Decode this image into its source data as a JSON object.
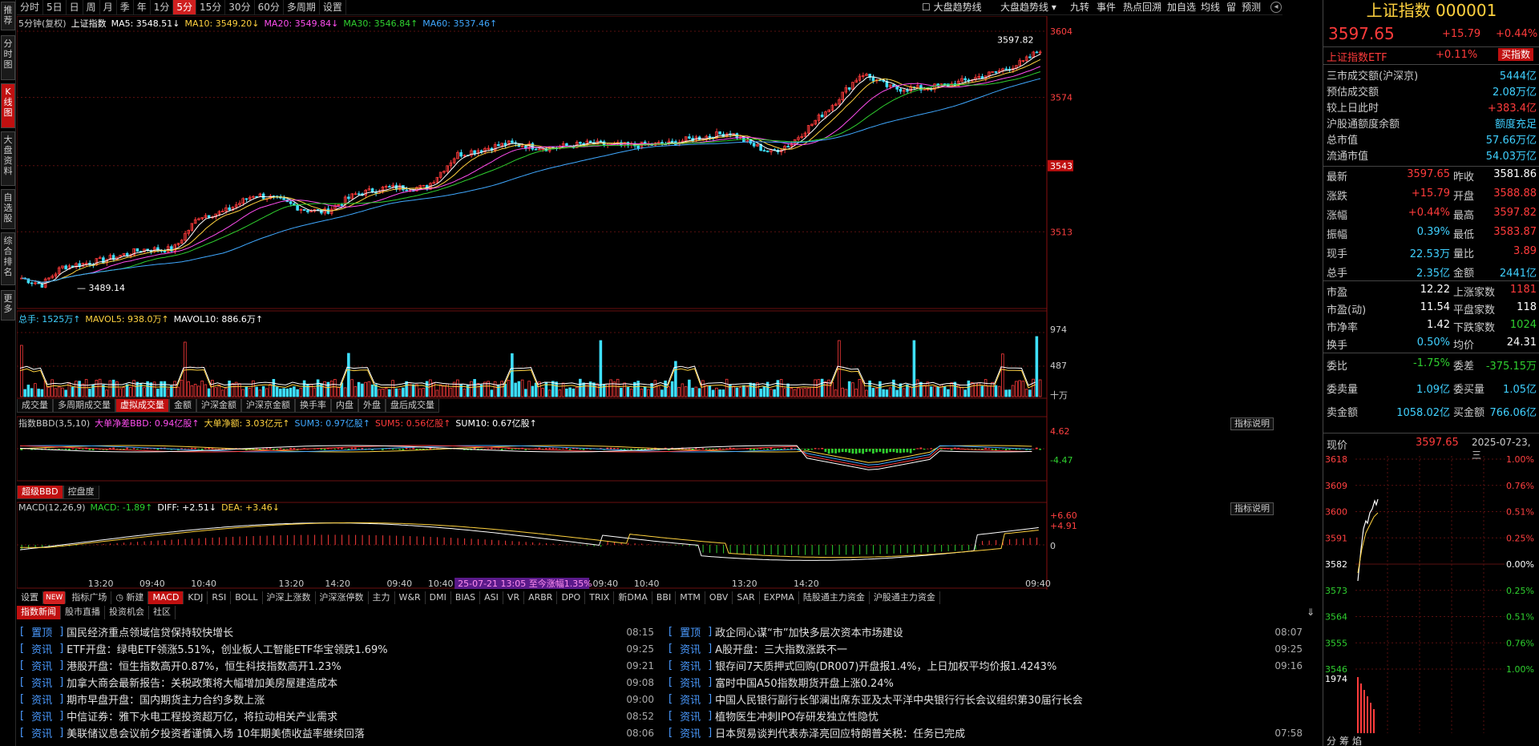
{
  "left_tabs": [
    "推荐",
    "分时图",
    "K线图",
    "大盘资料",
    "自选股",
    "综合排名",
    "更多"
  ],
  "periods": [
    "分时",
    "5日",
    "日",
    "周",
    "月",
    "季",
    "年",
    "1分",
    "5分",
    "15分",
    "30分",
    "60分",
    "多周期",
    "设置"
  ],
  "active_period": "5分",
  "top_tools": {
    "check1": "大盘趋势线",
    "drop1": "大盘趋势线 ▾",
    "t1": "九转",
    "t2": "事件",
    "t3": "热点回溯",
    "t4": "加自选",
    "t5": "均线",
    "t6": "留",
    "t7": "预测"
  },
  "kline_legend": {
    "period": "5分钟(复权)",
    "name": "上证指数",
    "ma5": "MA5: 3548.51↓",
    "ma10": "MA10: 3549.20↓",
    "ma20": "MA20: 3549.84↓",
    "ma30": "MA30: 3546.84↑",
    "ma60": "MA60: 3537.46↑"
  },
  "price_axis": [
    "3604",
    "3574",
    "3543",
    "3513"
  ],
  "high_label": "3597.82",
  "low_label": "3489.14",
  "vol_legend": {
    "total": "总手: 1525万↑",
    "ma5": "MAVOL5: 938.0万↑",
    "ma10": "MAVOL10: 886.6万↑"
  },
  "vol_axis": [
    "974",
    "487",
    "十万"
  ],
  "vol_tabs": [
    "成交量",
    "多周期成交量",
    "虚拟成交量",
    "金额",
    "沪深金额",
    "沪深京金额",
    "换手率",
    "内盘",
    "外盘",
    "盘后成交量"
  ],
  "vol_tab_active": "虚拟成交量",
  "bbd_legend": {
    "a": "指数BBD(3,5,10)",
    "b": "大单净差BBD: 0.94亿股↑",
    "c": "大单净额: 3.03亿元↑",
    "d": "SUM3: 0.97亿股↑",
    "e": "SUM5: 0.56亿股↑",
    "f": "SUM10: 0.67亿股↑"
  },
  "bbd_axis": [
    "4.62",
    "-4.47"
  ],
  "bbd_tabs": [
    "超级BBD",
    "控盘度"
  ],
  "explain": "指标说明",
  "macd_legend": {
    "a": "MACD(12,26,9)",
    "b": "MACD: -1.89↑",
    "c": "DIFF: +2.51↓",
    "d": "DEA: +3.46↓"
  },
  "macd_axis": [
    "+6.60",
    "+4.91",
    "0"
  ],
  "time_axis": [
    "13:20",
    "09:40",
    "10:40",
    "13:20",
    "14:20",
    "09:40",
    "10:40",
    "14:20",
    "09:40",
    "10:40",
    "13:20",
    "14:20",
    "09:40"
  ],
  "highlight_label": "25-07-21 13:05 至今涨幅1.35%",
  "ind_tabs": [
    "设置",
    "NEW",
    "指标广场",
    "◷ 新建",
    "MACD",
    "KDJ",
    "RSI",
    "BOLL",
    "沪深上涨数",
    "沪深涨停数",
    "主力",
    "W&R",
    "DMI",
    "BIAS",
    "ASI",
    "VR",
    "ARBR",
    "DPO",
    "TRIX",
    "新DMA",
    "BBI",
    "MTM",
    "OBV",
    "SAR",
    "EXPMA",
    "陆股通主力资金",
    "沪股通主力资金"
  ],
  "ind_active": "MACD",
  "news_tabs": [
    "指数新闻",
    "股市直播",
    "投资机会",
    "社区"
  ],
  "news_left": [
    {
      "cat": "置顶",
      "title": "国民经济重点领域信贷保持较快增长",
      "time": "08:15"
    },
    {
      "cat": "资讯",
      "title": "ETF开盘：绿电ETF领涨5.51%，创业板人工智能ETF华宝领跌1.69%",
      "time": "09:25"
    },
    {
      "cat": "资讯",
      "title": "港股开盘：恒生指数高开0.87%，恒生科技指数高开1.23%",
      "time": "09:21"
    },
    {
      "cat": "资讯",
      "title": "加拿大商会最新报告：关税政策将大幅增加美房屋建造成本",
      "time": "09:08"
    },
    {
      "cat": "资讯",
      "title": "期市早盘开盘：国内期货主力合约多数上涨",
      "time": "09:00"
    },
    {
      "cat": "资讯",
      "title": "中信证券：雅下水电工程投资超万亿，将拉动相关产业需求",
      "time": "08:52"
    },
    {
      "cat": "资讯",
      "title": "美联储议息会议前夕投资者谨慎入场 10年期美债收益率继续回落",
      "time": "08:06"
    }
  ],
  "news_right": [
    {
      "cat": "置顶",
      "title": "政企同心谋“市”加快多层次资本市场建设",
      "time": "08:07"
    },
    {
      "cat": "资讯",
      "title": "A股开盘：三大指数涨跌不一",
      "time": "09:25"
    },
    {
      "cat": "资讯",
      "title": "银存间7天质押式回购(DR007)开盘报1.4%，上日加权平均价报1.4243%",
      "time": "09:16"
    },
    {
      "cat": "资讯",
      "title": "富时中国A50指数期货开盘上涨0.24%",
      "time": ""
    },
    {
      "cat": "资讯",
      "title": "中国人民银行副行长邹澜出席东亚及太平洋中央银行行长会议组织第30届行长会",
      "time": ""
    },
    {
      "cat": "资讯",
      "title": "植物医生冲刺IPO存研发独立性隐忧",
      "time": ""
    },
    {
      "cat": "资讯",
      "title": "日本贸易谈判代表赤泽亮回应特朗普关税：任务已完成",
      "time": "07:58"
    }
  ],
  "quote": {
    "name": "上证指数 000001",
    "price": "3597.65",
    "chg": "+15.79",
    "pct": "+0.44%",
    "etf": "上证指数ETF",
    "etf_pct": "+0.11%",
    "buy": "买指数"
  },
  "info_rows": [
    {
      "l": "三市成交额(沪深京)",
      "v": "5444亿",
      "c": "cy"
    },
    {
      "l": "预估成交额",
      "v": "2.08万亿",
      "c": "cy"
    },
    {
      "l": "较上日此时",
      "v": "+383.4亿",
      "c": "up"
    },
    {
      "l": "沪股通额度余额",
      "v": "额度充足",
      "c": "cy"
    },
    {
      "l": "总市值",
      "v": "57.66万亿",
      "c": "cy"
    },
    {
      "l": "流通市值",
      "v": "54.03万亿",
      "c": "cy"
    }
  ],
  "stats": [
    {
      "a": "最新",
      "b": "3597.65",
      "bc": "up",
      "c": "昨收",
      "d": "3581.86",
      "dc": "wh"
    },
    {
      "a": "涨跌",
      "b": "+15.79",
      "bc": "up",
      "c": "开盘",
      "d": "3588.88",
      "dc": "up"
    },
    {
      "a": "涨幅",
      "b": "+0.44%",
      "bc": "up",
      "c": "最高",
      "d": "3597.82",
      "dc": "up"
    },
    {
      "a": "振幅",
      "b": "0.39%",
      "bc": "cy",
      "c": "最低",
      "d": "3583.87",
      "dc": "up"
    },
    {
      "a": "现手",
      "b": "22.53万",
      "bc": "cy",
      "c": "量比",
      "d": "3.89",
      "dc": "up"
    },
    {
      "a": "总手",
      "b": "2.35亿",
      "bc": "cy",
      "c": "金额",
      "d": "2441亿",
      "dc": "cy"
    }
  ],
  "stats2": [
    {
      "a": "市盈",
      "b": "12.22",
      "bc": "wh",
      "c": "上涨家数",
      "d": "1181",
      "dc": "up"
    },
    {
      "a": "市盈(动)",
      "b": "11.54",
      "bc": "wh",
      "c": "平盘家数",
      "d": "118",
      "dc": "wh"
    },
    {
      "a": "市净率",
      "b": "1.42",
      "bc": "wh",
      "c": "下跌家数",
      "d": "1024",
      "dc": "dn"
    },
    {
      "a": "换手",
      "b": "0.50%",
      "bc": "cy",
      "c": "均价",
      "d": "24.31",
      "dc": "wh"
    }
  ],
  "stats3": [
    {
      "a": "委比",
      "b": "-1.75%",
      "bc": "dn",
      "c": "委差",
      "d": "-375.15万",
      "dc": "dn"
    },
    {
      "a": "委卖量",
      "b": "1.09亿",
      "bc": "cy",
      "c": "委买量",
      "d": "1.05亿",
      "dc": "cy"
    },
    {
      "a": "卖金额",
      "b": "1058.02亿",
      "bc": "cy",
      "c": "买金额",
      "d": "766.06亿",
      "dc": "cy"
    }
  ],
  "mini": {
    "label": "现价",
    "price": "3597.65",
    "date": "2025-07-23,三",
    "left_axis": [
      "3618",
      "3609",
      "3600",
      "3591",
      "3582",
      "3573",
      "3564",
      "3555",
      "3546"
    ],
    "right_axis": [
      "1.00%",
      "0.76%",
      "0.51%",
      "0.25%",
      "0.00%",
      "0.25%",
      "0.51%",
      "0.76%",
      "1.00%"
    ],
    "vol": "1974",
    "tabs": [
      "分",
      "筹",
      "焰"
    ]
  },
  "colors": {
    "ma5": "#ffffff",
    "ma10": "#ffd23f",
    "ma20": "#ff4ef0",
    "ma30": "#2fd02f",
    "ma60": "#3fa8ff",
    "up": "#ff3b3b",
    "down": "#3fe0ff"
  }
}
